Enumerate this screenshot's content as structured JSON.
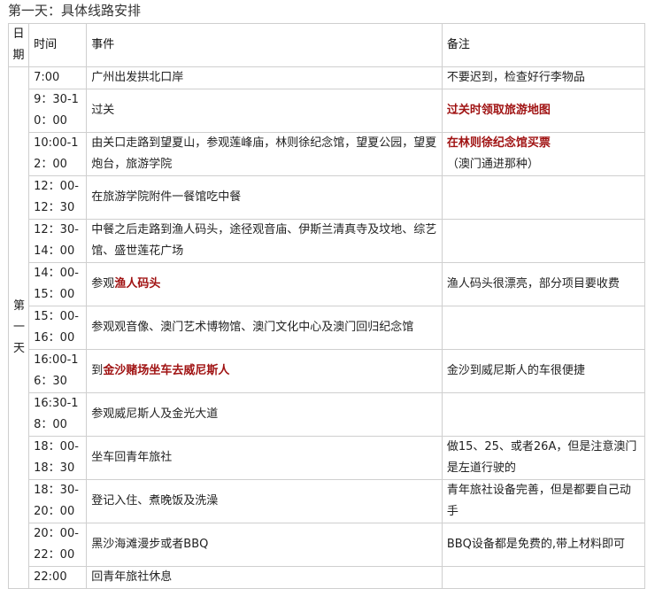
{
  "page_title": "第一天：具体线路安排",
  "headers": {
    "date": "日期",
    "time": "时间",
    "event": "事件",
    "note": "备注"
  },
  "day_label": "第一天",
  "rows": [
    {
      "time": "7:00",
      "event_a": "广州出发拱北口岸",
      "event_red": "",
      "event_b": "",
      "note_red": "",
      "note": "不要迟到，检查好行李物品"
    },
    {
      "time": "9：30-10：00",
      "event_a": "过关",
      "event_red": "",
      "event_b": "",
      "note_red": "过关时领取旅游地图",
      "note": ""
    },
    {
      "time": "10:00-12：00",
      "event_a": "由关口走路到望夏山，参观莲峰庙，林则徐纪念馆，望夏公园，望夏炮台，旅游学院",
      "event_red": "",
      "event_b": "",
      "note_red": "在林则徐纪念馆买票",
      "note": "（澳门通进那种）"
    },
    {
      "time": "12：00-12：30",
      "event_a": "在旅游学院附件一餐馆吃中餐",
      "event_red": "",
      "event_b": "",
      "note_red": "",
      "note": ""
    },
    {
      "time": "12：30-14：00",
      "event_a": "中餐之后走路到渔人码头，途径观音庙、伊斯兰清真寺及坟地、综艺馆、盛世莲花广场",
      "event_red": "",
      "event_b": "",
      "note_red": "",
      "note": ""
    },
    {
      "time": "14：00-15：00",
      "event_a": "参观",
      "event_red": "渔人码头",
      "event_b": "",
      "note_red": "",
      "note": "渔人码头很漂亮，部分项目要收费"
    },
    {
      "time": "15：00-16：00",
      "event_a": "参观观音像、澳门艺术博物馆、澳门文化中心及澳门回归纪念馆",
      "event_red": "",
      "event_b": "",
      "note_red": "",
      "note": ""
    },
    {
      "time": "16:00-16：30",
      "event_a": "到",
      "event_red": "金沙赌场坐车去威尼斯人",
      "event_b": "",
      "note_red": "",
      "note": "金沙到威尼斯人的车很便捷"
    },
    {
      "time": "16:30-18：00",
      "event_a": "参观威尼斯人及金光大道",
      "event_red": "",
      "event_b": "",
      "note_red": "",
      "note": ""
    },
    {
      "time": "18：00-18：30",
      "event_a": "坐车回青年旅社",
      "event_red": "",
      "event_b": "",
      "note_red": "",
      "note": "做15、25、或者26A，但是注意澳门是左道行驶的"
    },
    {
      "time": "18：30-20：00",
      "event_a": "登记入住、煮晚饭及洗澡",
      "event_red": "",
      "event_b": "",
      "note_red": "",
      "note": "青年旅社设备完善，但是都要自己动手"
    },
    {
      "time": "20：00-22：00",
      "event_a": "黑沙海滩漫步或者BBQ",
      "event_red": "",
      "event_b": "",
      "note_red": "",
      "note": "BBQ设备都是免费的,带上材料即可"
    },
    {
      "time": "22:00",
      "event_a": "回青年旅社休息",
      "event_red": "",
      "event_b": "",
      "note_red": "",
      "note": ""
    }
  ]
}
